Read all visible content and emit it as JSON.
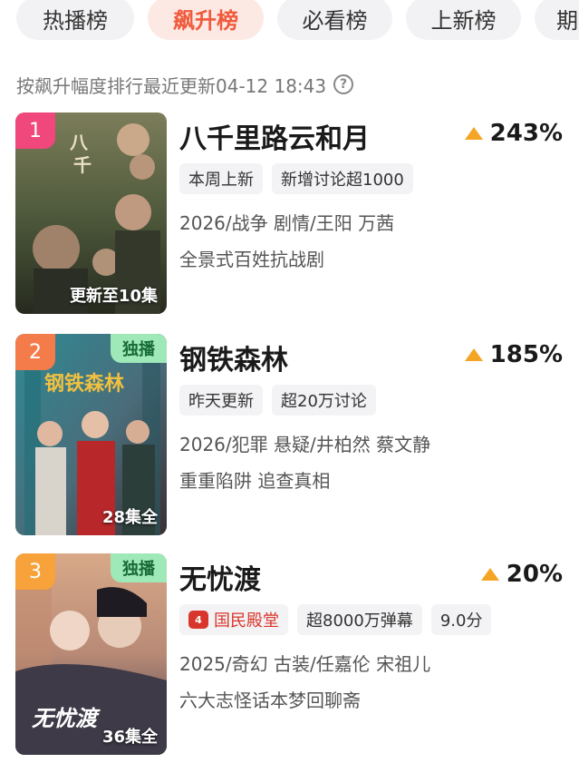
{
  "tabs": [
    {
      "label": "热播榜",
      "active": false
    },
    {
      "label": "飙升榜",
      "active": true
    },
    {
      "label": "必看榜",
      "active": false
    },
    {
      "label": "上新榜",
      "active": false
    },
    {
      "label": "期",
      "active": false
    }
  ],
  "subtitle": {
    "text": "按飙升幅度排行最近更新04-12 18:43",
    "help_icon": "?"
  },
  "colors": {
    "accent": "#f05a3c",
    "rank1": "#f0477c",
    "rank2": "#f47b4a",
    "rank3": "#f7a23a",
    "trend_up": "#f5a524",
    "exclusive_bg": "#9fe8b8",
    "hall_red": "#d8362c"
  },
  "items": [
    {
      "rank": "1",
      "title": "八千里路云和月",
      "trend": "243%",
      "tags": [
        "本周上新",
        "新增讨论超1000"
      ],
      "meta": "2026/战争 剧情/王阳 万茜",
      "desc": "全景式百姓抗战剧",
      "episodes": "更新至10集",
      "exclusive": "",
      "hall_icon": "",
      "hall_label": ""
    },
    {
      "rank": "2",
      "title": "钢铁森林",
      "trend": "185%",
      "tags": [
        "昨天更新",
        "超20万讨论"
      ],
      "meta": "2026/犯罪 悬疑/井柏然 蔡文静",
      "desc": "重重陷阱 追查真相",
      "episodes": "28集全",
      "exclusive": "独播",
      "hall_icon": "",
      "hall_label": ""
    },
    {
      "rank": "3",
      "title": "无忧渡",
      "trend": "20%",
      "tags": [
        "超8000万弹幕",
        "9.0分"
      ],
      "meta": "2025/奇幻 古装/任嘉伦 宋祖儿",
      "desc": "六大志怪话本梦回聊斋",
      "episodes": "36集全",
      "exclusive": "独播",
      "hall_icon": "4",
      "hall_label": "国民殿堂"
    }
  ]
}
